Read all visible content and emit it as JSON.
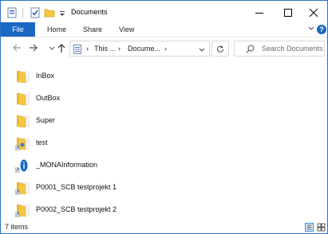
{
  "window": {
    "title": "Documents"
  },
  "ribbon": {
    "tabs": {
      "file": "File",
      "home": "Home",
      "share": "Share",
      "view": "View"
    },
    "help": "?"
  },
  "address": {
    "crumbs": [
      "This ...",
      "Docume..."
    ],
    "separator": "›"
  },
  "search": {
    "placeholder": "Search Documents"
  },
  "items": [
    {
      "label": "InBox",
      "icon": "folder-icon"
    },
    {
      "label": "OutBox",
      "icon": "folder-icon"
    },
    {
      "label": "Super",
      "icon": "folder-icon"
    },
    {
      "label": "test",
      "icon": "folder-shortcut-icon"
    },
    {
      "label": "_MONAInformation",
      "icon": "info-shortcut-icon"
    },
    {
      "label": "P0001_SCB testprojekt 1",
      "icon": "folder-shortcut-icon"
    },
    {
      "label": "P0002_SCB testprojekt 2",
      "icon": "folder-shortcut-icon"
    }
  ],
  "status": {
    "count": "7 items"
  },
  "colors": {
    "accent": "#1a67c4",
    "folder": "#f5c842",
    "folder_dark": "#e0a81e"
  }
}
